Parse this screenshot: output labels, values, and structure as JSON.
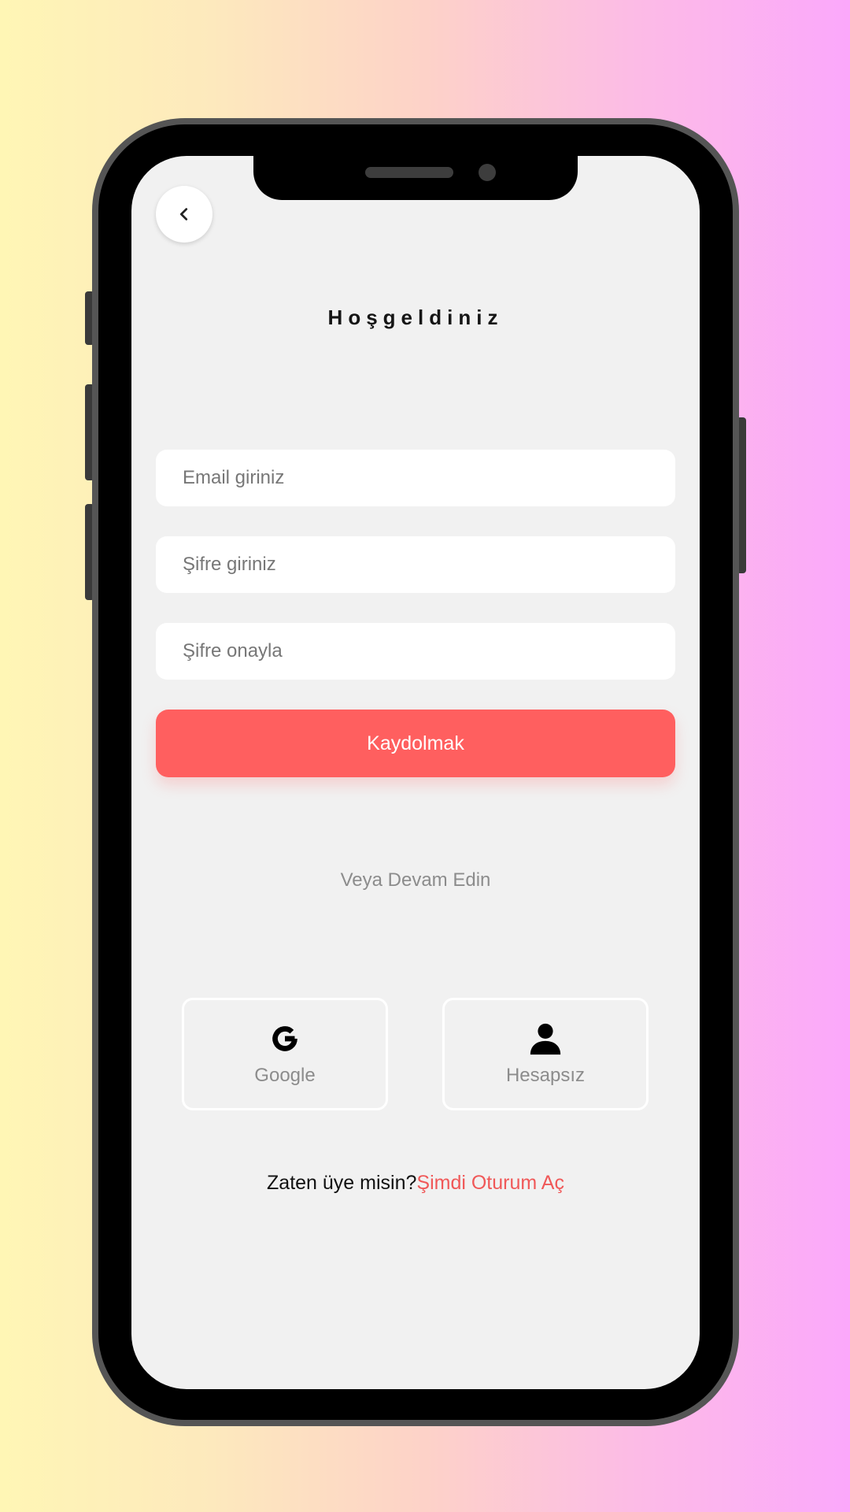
{
  "background": {
    "gradient_start": "#fff6b5",
    "gradient_end": "#fba8fb"
  },
  "header": {
    "back_icon": "chevron-left-icon",
    "title": "Hoşgeldiniz"
  },
  "form": {
    "email_placeholder": "Email giriniz",
    "password_placeholder": "Şifre giriniz",
    "confirm_placeholder": "Şifre onayla",
    "submit_label": "Kaydolmak",
    "submit_color": "#ff5f5f"
  },
  "divider": {
    "label": "Veya Devam Edin"
  },
  "social": [
    {
      "label": "Google",
      "icon": "google-icon"
    },
    {
      "label": "Hesapsız",
      "icon": "person-icon"
    }
  ],
  "footer": {
    "prompt": "Zaten üye misin?",
    "link": "Şimdi Oturum Aç",
    "link_color": "#f05858"
  }
}
